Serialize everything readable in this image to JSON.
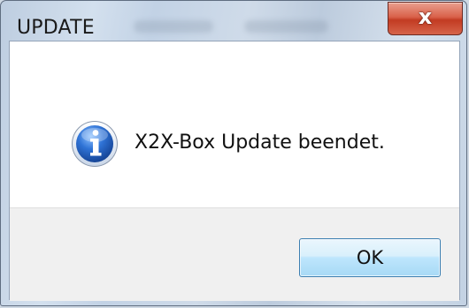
{
  "window": {
    "title": "UPDATE",
    "close_glyph": "x",
    "close_icon": "close-icon"
  },
  "message": {
    "text": "X2X-Box Update beendet.",
    "icon": "info-icon"
  },
  "buttons": {
    "ok_label": "OK"
  },
  "colors": {
    "close_button": "#c8452c",
    "ok_border": "#3c7fb1",
    "info_icon": "#1f5fbf",
    "button_bar": "#f0f0f0"
  }
}
